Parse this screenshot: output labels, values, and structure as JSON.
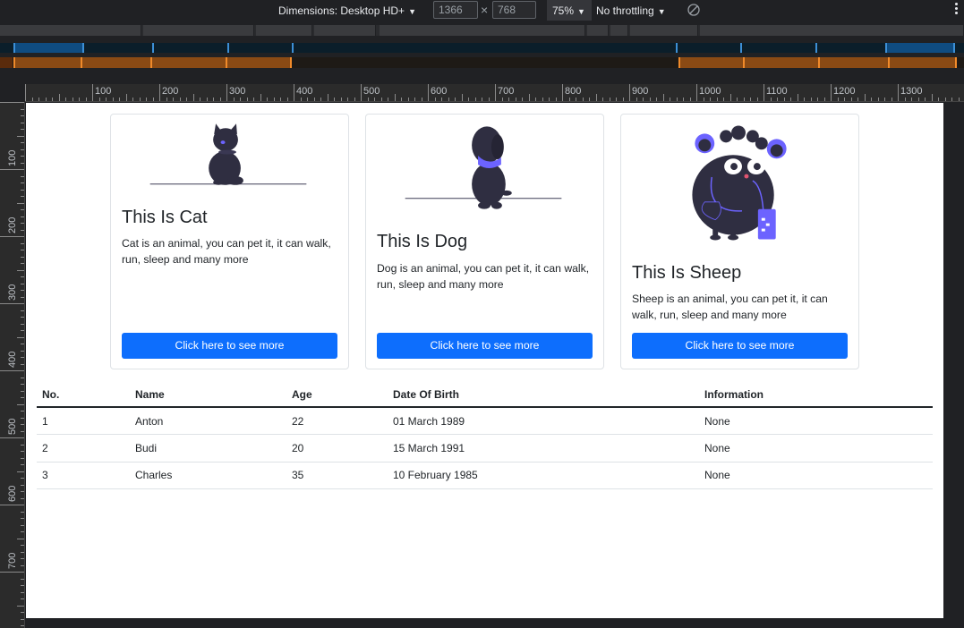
{
  "devtools": {
    "device_label": "Dimensions: Desktop HD+",
    "width_value": "1366",
    "height_value": "768",
    "times_symbol": "×",
    "zoom": "75%",
    "throttling": "No throttling",
    "ruler_top_labels": [
      "100",
      "200",
      "300",
      "400",
      "500",
      "600",
      "700",
      "800",
      "900",
      "1000",
      "1100",
      "1200",
      "1300"
    ],
    "ruler_left_labels": [
      "100",
      "200",
      "300",
      "400",
      "500",
      "600",
      "700"
    ]
  },
  "cards": [
    {
      "title": "This Is Cat",
      "text": "Cat is an animal, you can pet it, it can walk, run, sleep and many more",
      "button": "Click here to see more",
      "image_icon": "cat-illustration"
    },
    {
      "title": "This Is Dog",
      "text": "Dog is an animal, you can pet it, it can walk, run, sleep and many more",
      "button": "Click here to see more",
      "image_icon": "dog-illustration"
    },
    {
      "title": "This Is Sheep",
      "text": "Sheep is an animal, you can pet it, it can walk, run, sleep and many more",
      "button": "Click here to see more",
      "image_icon": "sheep-illustration"
    }
  ],
  "table": {
    "headers": [
      "No.",
      "Name",
      "Age",
      "Date Of Birth",
      "Information"
    ],
    "rows": [
      [
        "1",
        "Anton",
        "22",
        "01 March 1989",
        "None"
      ],
      [
        "2",
        "Budi",
        "20",
        "15 March 1991",
        "None"
      ],
      [
        "3",
        "Charles",
        "35",
        "10 February 1985",
        "None"
      ]
    ]
  },
  "colors": {
    "primary_button": "#0d6efd",
    "illustration_dark": "#2f2e41",
    "illustration_accent": "#6c63ff",
    "devtools_bg": "#202124"
  }
}
